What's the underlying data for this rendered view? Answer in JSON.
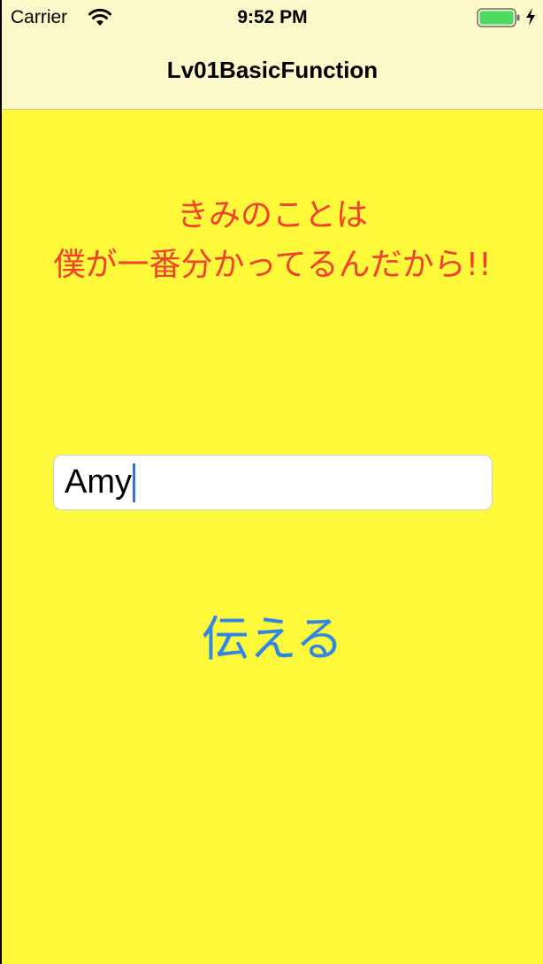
{
  "status_bar": {
    "carrier": "Carrier",
    "time": "9:52 PM",
    "wifi_icon": "wifi-icon",
    "battery_icon": "battery-icon",
    "charging_icon": "charging-bolt-icon"
  },
  "nav_bar": {
    "title": "Lv01BasicFunction"
  },
  "main": {
    "message_line1": "きみのことは",
    "message_line2": "僕が一番分かってるんだから!!",
    "name_field_value": "Amy",
    "send_button_label": "伝える"
  },
  "colors": {
    "background": "#fef93a",
    "nav_background": "#fbf8c9",
    "message_text": "#f2402d",
    "button_text": "#2e86e8",
    "battery": "#4cd964"
  }
}
